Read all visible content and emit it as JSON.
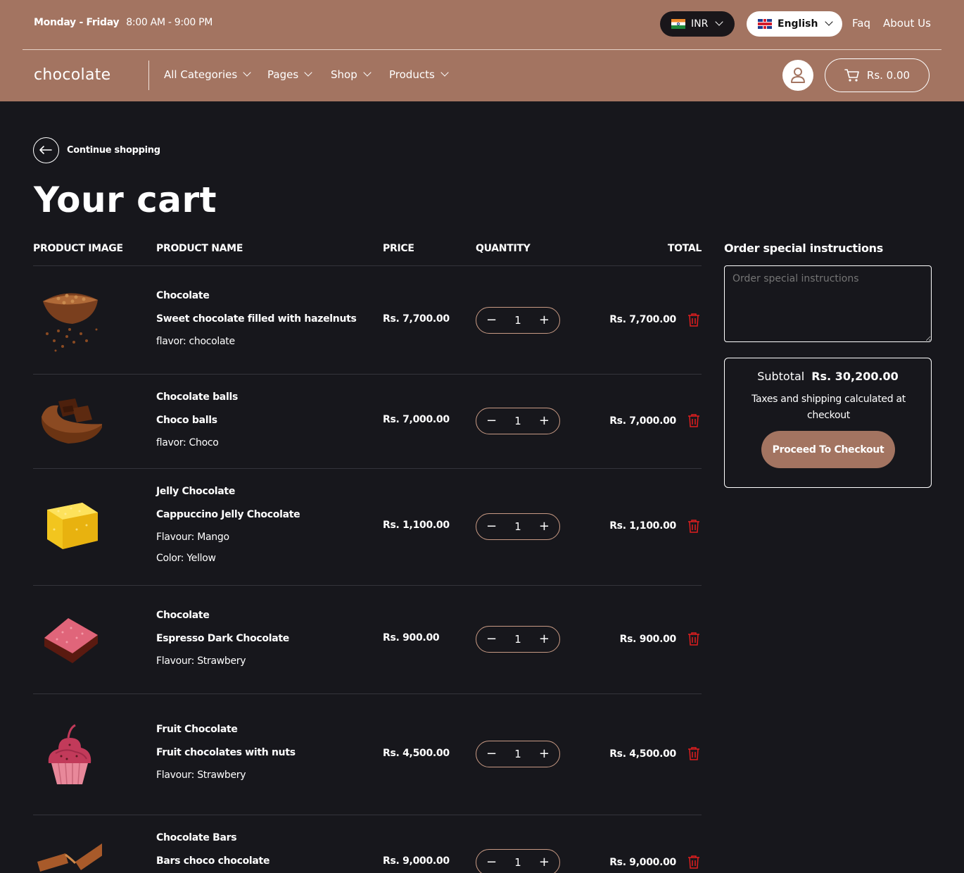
{
  "topbar": {
    "days": "Monday - Friday",
    "time": "8:00 AM - 9:00 PM",
    "currency": "INR",
    "language": "English",
    "links": [
      "Faq",
      "About Us"
    ]
  },
  "header": {
    "logo": "chocolate",
    "nav": [
      "All Categories",
      "Pages",
      "Shop",
      "Products"
    ],
    "cart_total": "Rs. 0.00"
  },
  "page": {
    "back_label": "Continue shopping",
    "title": "Your cart"
  },
  "table": {
    "headers": [
      "PRODUCT IMAGE",
      "PRODUCT NAME",
      "PRICE",
      "QUANTITY",
      "TOTAL"
    ],
    "rows": [
      {
        "name": "Chocolate",
        "subtitle": "Sweet chocolate filled with hazelnuts",
        "options": [
          "flavor: chocolate"
        ],
        "price": "Rs. 7,700.00",
        "qty": "1",
        "total": "Rs. 7,700.00"
      },
      {
        "name": "Chocolate balls",
        "subtitle": "Choco balls",
        "options": [
          "flavor: Choco"
        ],
        "price": "Rs. 7,000.00",
        "qty": "1",
        "total": "Rs. 7,000.00"
      },
      {
        "name": "Jelly Chocolate",
        "subtitle": "Cappuccino Jelly Chocolate",
        "options": [
          "Flavour: Mango",
          "Color: Yellow"
        ],
        "price": "Rs. 1,100.00",
        "qty": "1",
        "total": "Rs. 1,100.00"
      },
      {
        "name": "Chocolate",
        "subtitle": "Espresso Dark Chocolate",
        "options": [
          "Flavour: Strawbery"
        ],
        "price": "Rs. 900.00",
        "qty": "1",
        "total": "Rs. 900.00"
      },
      {
        "name": "Fruit Chocolate",
        "subtitle": "Fruit chocolates with nuts",
        "options": [
          "Flavour: Strawbery"
        ],
        "price": "Rs. 4,500.00",
        "qty": "1",
        "total": "Rs. 4,500.00"
      },
      {
        "name": "Chocolate Bars",
        "subtitle": "Bars choco chocolate",
        "options": [],
        "price": "Rs. 9,000.00",
        "qty": "1",
        "total": "Rs. 9,000.00"
      }
    ]
  },
  "sidebar": {
    "instructions_title": "Order special instructions",
    "instructions_placeholder": "Order special instructions",
    "subtotal_label": "Subtotal",
    "subtotal_value": "Rs. 30,200.00",
    "tax_note": "Taxes and shipping calculated at checkout",
    "checkout_label": "Proceed To Checkout"
  },
  "icons": {
    "minus": "minus-icon",
    "plus": "plus-icon",
    "delete": "trash-icon",
    "user": "user-icon",
    "cart": "cart-icon",
    "back": "arrow-left-icon"
  },
  "colors": {
    "header_bg": "#a37461",
    "page_bg": "#17171c",
    "accent": "#a37461",
    "delete": "#e01e1e"
  }
}
